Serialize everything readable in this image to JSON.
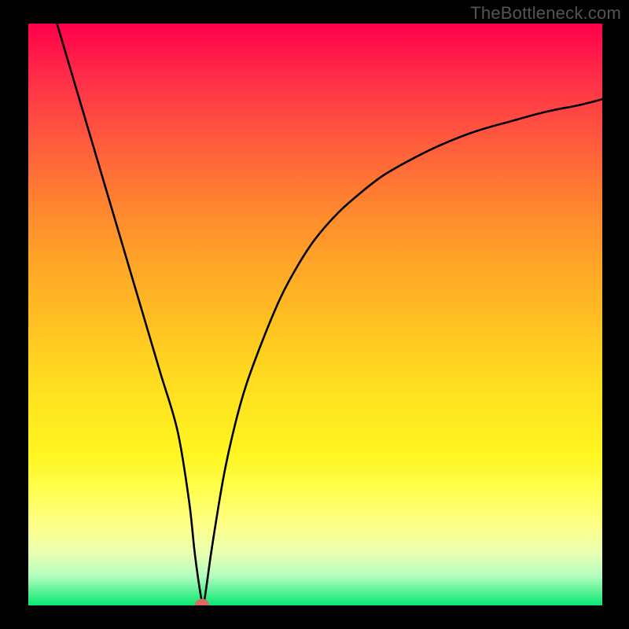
{
  "watermark": "TheBottleneck.com",
  "chart_data": {
    "type": "line",
    "title": "",
    "xlabel": "",
    "ylabel": "",
    "xlim": [
      0,
      100
    ],
    "ylim": [
      0,
      100
    ],
    "x": [
      5,
      8,
      11,
      14,
      17,
      20,
      23,
      26,
      28,
      29,
      30,
      30.5,
      31,
      32,
      34,
      36,
      38,
      41,
      44,
      47,
      50,
      54,
      58,
      62,
      67,
      72,
      78,
      84,
      90,
      96,
      100
    ],
    "values": [
      100,
      90,
      80,
      70,
      60,
      50,
      40,
      30,
      18,
      9,
      2,
      0.3,
      3,
      10,
      22,
      31,
      38,
      46,
      53,
      58.5,
      63,
      67.5,
      71,
      74,
      76.8,
      79.2,
      81.5,
      83.2,
      84.8,
      86,
      87
    ],
    "marker": {
      "x": 30.3,
      "y": 0.2
    },
    "note": "Values are approximate readings from the plotted V-shaped curve on a 0–100 normalized axis; vertex near x≈30 at the bottom edge."
  },
  "colors": {
    "background": "#000000",
    "curve": "#000000",
    "marker": "#d96a5d",
    "watermark": "#545454"
  }
}
